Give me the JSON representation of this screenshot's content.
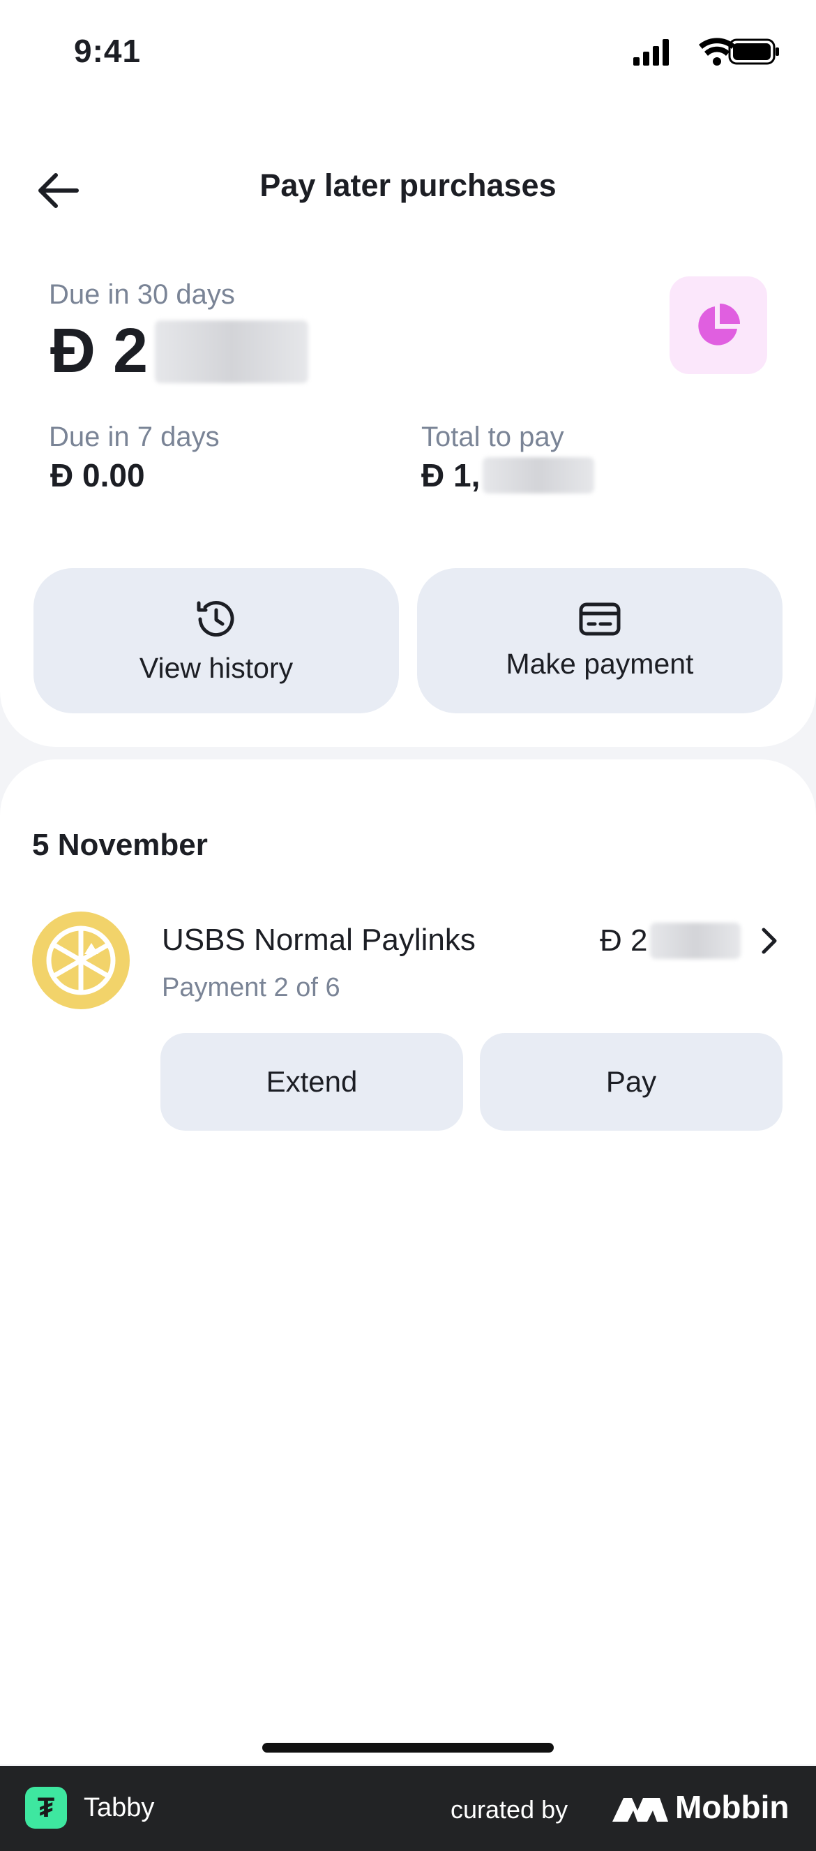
{
  "status_bar": {
    "time": "9:41"
  },
  "header": {
    "title": "Pay later purchases"
  },
  "summary": {
    "due_30_label": "Due in 30 days",
    "due_30_amount": "Đ 2",
    "due_7_label": "Due in 7 days",
    "due_7_amount": "Đ 0.00",
    "total_label": "Total to pay",
    "total_amount": "Đ 1,"
  },
  "actions": {
    "view_history": "View history",
    "make_payment": "Make payment"
  },
  "purchases": {
    "date": "5 November",
    "item": {
      "merchant": "USBS Normal Paylinks",
      "subtitle": "Payment 2 of 6",
      "amount": "Đ 2",
      "extend_label": "Extend",
      "pay_label": "Pay"
    }
  },
  "footer": {
    "app_icon_glyph": "₮",
    "app_name": "Tabby",
    "curated_by": "curated by",
    "brand": "Mobbin"
  },
  "colors": {
    "accent_pink": "#e05fe0",
    "button_bg": "#e8ecf4",
    "merchant_logo": "#f2d36a",
    "tabby_green": "#3ee7a0"
  }
}
